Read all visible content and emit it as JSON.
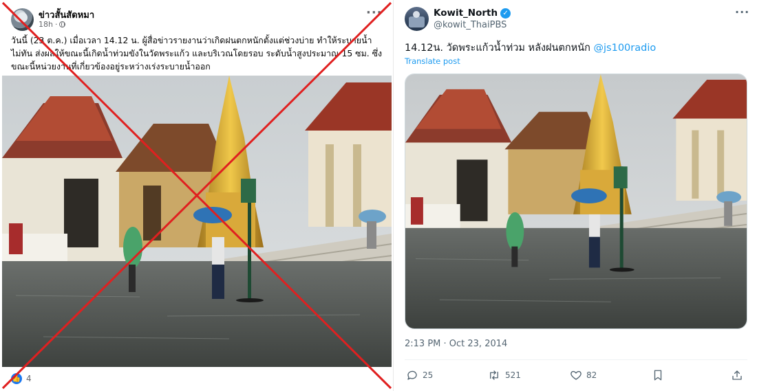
{
  "facebook_post": {
    "page_name": "ข่าวสั้นสัดหมา",
    "time": "18h",
    "privacy_icon": "globe-icon",
    "more_icon": "more-horizontal-icon",
    "body": "วันนี้ (23 ต.ค.) เมื่อเวลา 14.12 น. ผู้สื่อข่าวรายงานว่าเกิดฝนตกหนักตั้งแต่ช่วงบ่าย ทำให้ระบายน้ำไม่ทัน ส่งผลให้ขณะนี้เกิดน้ำท่วมขังในวัดพระแก้ว และบริเวณโดยรอบ ระดับน้ำสูงประมาณ 15 ซม. ซึ่งขณะนี้หน่วยงานที่เกี่ยวข้องอยู่ระหว่างเร่งระบายน้ำออก",
    "reaction_icon": "like-icon",
    "reaction_count": "4",
    "overlay": "red-cross-mark",
    "overlay_color": "#e02020"
  },
  "x_post": {
    "display_name": "Kowit_North",
    "verified_icon": "verified-badge-icon",
    "handle": "@kowit_ThaiPBS",
    "text": "14.12น. วัดพระแก้วน้ำท่วม หลังฝนตกหนัก ",
    "mention": "@js100radio",
    "translate_label": "Translate post",
    "timestamp": "2:13 PM · Oct 23, 2014",
    "actions": {
      "reply_count": "25",
      "repost_count": "521",
      "like_count": "82"
    },
    "accent_color": "#1d9bf0"
  },
  "photo": {
    "subject": "Flooded courtyard at Wat Phra Kaew with golden stupa and visitors with umbrellas"
  }
}
